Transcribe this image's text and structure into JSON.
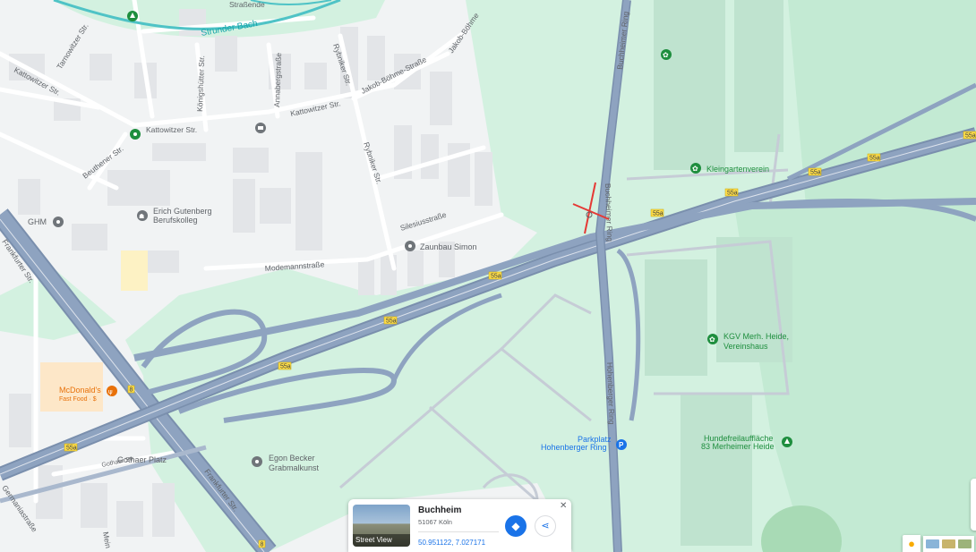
{
  "colors": {
    "land": "#f1f3f4",
    "green": "#d3f1e0",
    "highway": "#8ea3c0",
    "highway_edge": "#7a8fad",
    "water": "#4fc3c6",
    "poi_green": "#1e8e3e",
    "poi_gray": "#70757a",
    "poi_orange": "#e8710a",
    "parking": "#1a73e8",
    "marker": "#e53935"
  },
  "streets": {
    "kattowitzer_1": "Kattowitzer Str.",
    "kattowitzer_2": "Kattowitzer Str.",
    "kattowitzer_3": "Kattowitzer Str.",
    "tarnowitzer": "Tarnowitzer Str.",
    "koenigshuetter": "Königshütter Str.",
    "annaberg": "Annabergstraße",
    "rybniker_1": "Rybniker Str.",
    "rybniker_2": "Rybniker Str.",
    "jakob_boehme_1": "Jakob-Böhme-Straße",
    "jakob_boehme_2": "Jakob-Böhme",
    "beuthener": "Beuthener Str.",
    "silesius": "Silesiusstraße",
    "modemann": "Modemannstraße",
    "frankfurter_1": "Frankfurter Str.",
    "frankfurter_2": "Frankfurter Str.",
    "buchheimer_1": "Buchheimer Ring",
    "buchheimer_2": "Buchheimer Ring",
    "hohenberger": "Hohenberger Ring",
    "gothaer_str": "Gothaer Str.",
    "germania": "Germaniastraße",
    "strasse_top": "Straßende",
    "mein": "Mein"
  },
  "water_label": "Strunder Bach",
  "shields": [
    "55a",
    "55a",
    "55a",
    "55a",
    "55a",
    "55a",
    "55a",
    "55a",
    "55a",
    "8",
    "8"
  ],
  "pois": {
    "erich": {
      "line1": "Erich Gutenberg",
      "line2": "Berufskolleg"
    },
    "ghm": "GHM",
    "zaunbau": "Zaunbau Simon",
    "kleingarten": "Kleingartenverein",
    "kgv": {
      "line1": "KGV Merh. Heide,",
      "line2": "Vereinshaus"
    },
    "mcd": {
      "line1": "McDonald's",
      "line2": "Fast Food · $"
    },
    "parkplatz": {
      "line1": "Parkplatz",
      "line2": "Hohenberger Ring"
    },
    "hunde": {
      "line1": "Hundefreilauffläche",
      "line2": "83 Merheimer Heide"
    },
    "egon": {
      "line1": "Egon Becker",
      "line2": "Grabmalkunst"
    },
    "gothaer_platz": "Gothaer Platz"
  },
  "info_card": {
    "title": "Buchheim",
    "subtitle": "51067 Köln",
    "coords": "50.951122, 7.027171",
    "thumb_label": "Street View",
    "close_icon": "close-icon",
    "directions_icon": "directions-icon",
    "share_icon": "share-icon"
  },
  "controls": {
    "pegman_icon": "pegman-icon",
    "layers_icon": "layers-icon"
  }
}
